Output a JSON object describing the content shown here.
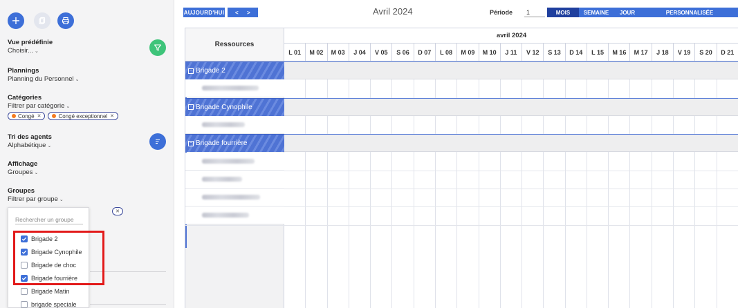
{
  "colors": {
    "accent": "#3d6fd8",
    "accent_dark": "#1f3f9e",
    "green": "#3ec47a",
    "highlight": "#e21a1a",
    "chip_dot": "#f47b20"
  },
  "sidebar": {
    "buttons": [
      {
        "icon": "plus-icon"
      },
      {
        "icon": "copy-icon"
      },
      {
        "icon": "print-icon"
      }
    ],
    "vue_predefinie": {
      "title": "Vue prédéfinie",
      "value": "Choisir...",
      "action_icon": "filter-icon"
    },
    "plannings": {
      "title": "Plannings",
      "value": "Planning du Personnel"
    },
    "categories": {
      "title": "Catégories",
      "value": "Filtrer par catégorie",
      "chips": [
        "Congé",
        "Congé exceptionnel"
      ]
    },
    "tri": {
      "title": "Tri des agents",
      "value": "Alphabétique",
      "action_icon": "sort-icon"
    },
    "affichage": {
      "title": "Affichage",
      "value": "Groupes"
    },
    "groupes": {
      "title": "Groupes",
      "value": "Filtrer par groupe",
      "search_placeholder": "Rechercher un groupe",
      "items": [
        {
          "label": "Brigade 2",
          "checked": true
        },
        {
          "label": "Brigade Cynophile",
          "checked": true
        },
        {
          "label": "Brigade de choc",
          "checked": false
        },
        {
          "label": "Brigade fourrière",
          "checked": true
        },
        {
          "label": "Brigade Matin",
          "checked": false
        },
        {
          "label": "brigade speciale",
          "checked": false
        }
      ]
    }
  },
  "toolbar": {
    "today": "AUJOURD'HUI",
    "prev": "<",
    "next": ">",
    "title": "Avril 2024",
    "periode_label": "Période",
    "periode_value": "1",
    "views": [
      "MOIS",
      "SEMAINE",
      "JOUR",
      "PERSONNALISÉE"
    ],
    "active_view": "MOIS"
  },
  "scheduler": {
    "resources_header": "Ressources",
    "month_label": "avril 2024",
    "days": [
      "L 01",
      "M 02",
      "M 03",
      "J 04",
      "V 05",
      "S 06",
      "D 07",
      "L 08",
      "M 09",
      "M 10",
      "J 11",
      "V 12",
      "S 13",
      "D 14",
      "L 15",
      "M 16",
      "M 17",
      "J 18",
      "V 19",
      "S 20",
      "D 21"
    ],
    "groups": [
      {
        "name": "Brigade 2",
        "members": 1
      },
      {
        "name": "Brigade Cynophile",
        "members": 1
      },
      {
        "name": "Brigade fourrière",
        "members": 4
      }
    ]
  }
}
